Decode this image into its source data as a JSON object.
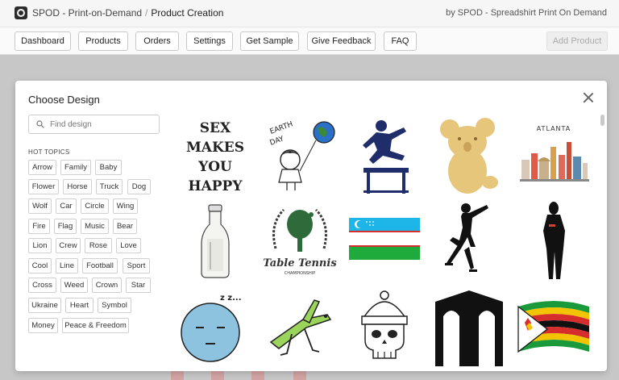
{
  "header": {
    "app_title": "SPOD - Print-on-Demand",
    "separator": "/",
    "current_page": "Product Creation",
    "byline": "by SPOD - Spreadshirt Print On Demand"
  },
  "nav": {
    "items": [
      {
        "label": "Dashboard"
      },
      {
        "label": "Products"
      },
      {
        "label": "Orders"
      },
      {
        "label": "Settings"
      },
      {
        "label": "Get Sample"
      },
      {
        "label": "Give Feedback"
      },
      {
        "label": "FAQ"
      }
    ],
    "add_product_label": "Add Product"
  },
  "modal": {
    "title": "Choose Design",
    "search_placeholder": "Find design",
    "hot_topics_label": "HOT TOPICS",
    "tags": [
      "Arrow",
      "Family",
      "Baby",
      "Flower",
      "Horse",
      "Truck",
      "Dog",
      "Wolf",
      "Car",
      "Circle",
      "Wing",
      "Fire",
      "Flag",
      "Music",
      "Bear",
      "Lion",
      "Crew",
      "Rose",
      "Love",
      "Cool",
      "Line",
      "Football",
      "Sport",
      "Cross",
      "Weed",
      "Crown",
      "Star",
      "Ukraine",
      "Heart",
      "Symbol",
      "Money",
      "Peace & Freedom"
    ],
    "designs": [
      {
        "icon": "sex-makes-you-happy-text",
        "text": "SEX MAKES YOU HAPPY"
      },
      {
        "icon": "earth-day-girl-balloon",
        "text": "EARTH DAY"
      },
      {
        "icon": "hurdle-jumper-silhouette"
      },
      {
        "icon": "koala"
      },
      {
        "icon": "atlanta-skyline",
        "text": "ATLANTA"
      },
      {
        "icon": "milk-bottle"
      },
      {
        "icon": "table-tennis-emblem",
        "text": "Table Tennis",
        "subtext": "CHAMPIONSHIP"
      },
      {
        "icon": "uzbekistan-flag"
      },
      {
        "icon": "figure-skater-silhouette"
      },
      {
        "icon": "woman-silhouette"
      },
      {
        "icon": "sleeping-face",
        "text": "z z..."
      },
      {
        "icon": "grasshopper"
      },
      {
        "icon": "skull-beanie"
      },
      {
        "icon": "arched-building-outline"
      },
      {
        "icon": "zimbabwe-flag"
      }
    ]
  }
}
